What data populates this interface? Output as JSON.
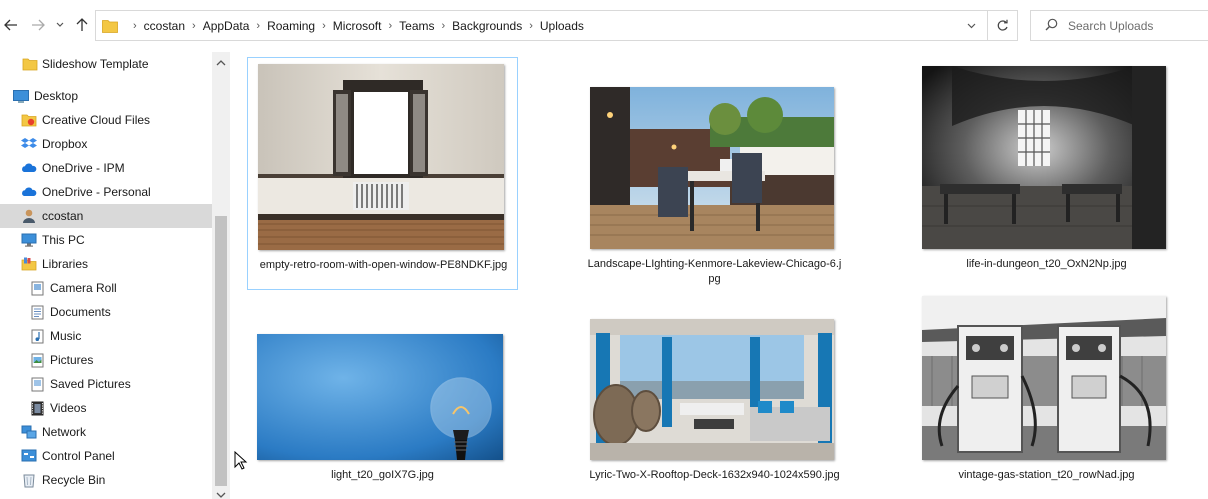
{
  "window": {
    "breadcrumb": [
      "ccostan",
      "AppData",
      "Roaming",
      "Microsoft",
      "Teams",
      "Backgrounds",
      "Uploads"
    ],
    "search_placeholder": "Search Uploads",
    "icons": {
      "back": "back-arrow-icon",
      "forward": "forward-arrow-icon",
      "recent": "chevron-down-icon",
      "up": "up-arrow-icon",
      "refresh": "refresh-icon",
      "search": "search-icon"
    }
  },
  "sidebar": {
    "items": [
      {
        "label": "Slideshow Template",
        "icon": "folder-icon"
      },
      {
        "label": "Desktop",
        "icon": "desktop-icon"
      },
      {
        "label": "Creative Cloud Files",
        "icon": "creative-cloud-folder-icon"
      },
      {
        "label": "Dropbox",
        "icon": "dropbox-icon"
      },
      {
        "label": "OneDrive - IPM",
        "icon": "onedrive-icon"
      },
      {
        "label": "OneDrive - Personal",
        "icon": "onedrive-icon"
      },
      {
        "label": "ccostan",
        "icon": "user-icon"
      },
      {
        "label": "This PC",
        "icon": "pc-icon"
      },
      {
        "label": "Libraries",
        "icon": "libraries-icon"
      },
      {
        "label": "Camera Roll",
        "icon": "library-folder-icon"
      },
      {
        "label": "Documents",
        "icon": "documents-icon"
      },
      {
        "label": "Music",
        "icon": "music-icon"
      },
      {
        "label": "Pictures",
        "icon": "pictures-icon"
      },
      {
        "label": "Saved Pictures",
        "icon": "library-folder-icon"
      },
      {
        "label": "Videos",
        "icon": "videos-icon"
      },
      {
        "label": "Network",
        "icon": "network-icon"
      },
      {
        "label": "Control Panel",
        "icon": "control-panel-icon"
      },
      {
        "label": "Recycle Bin",
        "icon": "recycle-bin-icon"
      }
    ],
    "selected": "ccostan"
  },
  "files": [
    {
      "name": "empty-retro-room-with-open-window-PE8NDKF.jpg",
      "selected": true
    },
    {
      "name": "Landscape-LIghting-Kenmore-Lakeview-Chicago-6.jpg",
      "selected": false
    },
    {
      "name": "life-in-dungeon_t20_OxN2Np.jpg",
      "selected": false
    },
    {
      "name": "light_t20_goIX7G.jpg",
      "selected": false
    },
    {
      "name": "Lyric-Two-X-Rooftop-Deck-1632x940-1024x590.jpg",
      "selected": false
    },
    {
      "name": "vintage-gas-station_t20_rowNad.jpg",
      "selected": false
    }
  ],
  "colors": {
    "selection_border": "#99d1ff",
    "nav_selected_bg": "#d9d9d9",
    "folder_yellow": "#f3c744"
  }
}
